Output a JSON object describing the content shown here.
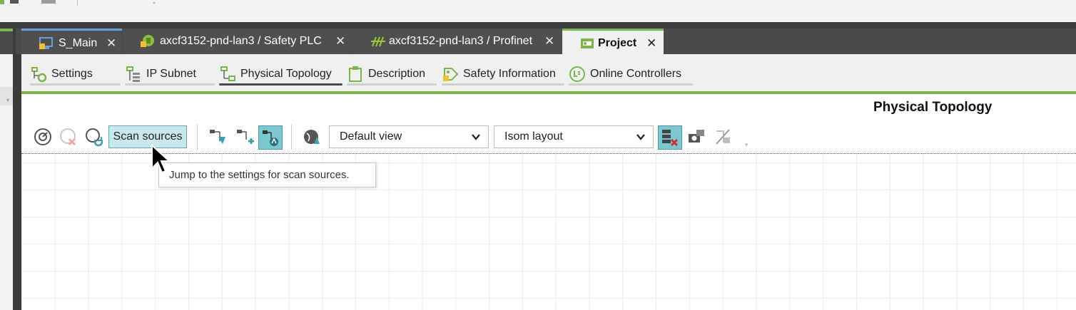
{
  "document_tabs": [
    {
      "label": "S_Main",
      "icon": "monitor-lock-icon",
      "active": false
    },
    {
      "label": "axcf3152-pnd-lan3 / Safety PLC",
      "icon": "safety-plc-icon",
      "active": false
    },
    {
      "label": "axcf3152-pnd-lan3 / Profinet",
      "icon": "profinet-icon",
      "active": false
    },
    {
      "label": "Project",
      "icon": "project-icon",
      "active": true
    }
  ],
  "close_glyph": "✕",
  "sub_tabs": [
    {
      "label": "Settings",
      "icon": "settings-tree-icon"
    },
    {
      "label": "IP Subnet",
      "icon": "ip-subnet-icon"
    },
    {
      "label": "Physical Topology",
      "icon": "topology-icon",
      "active": true
    },
    {
      "label": "Description",
      "icon": "clipboard-icon"
    },
    {
      "label": "Safety Information",
      "icon": "safety-tag-icon"
    },
    {
      "label": "Online Controllers",
      "icon": "online-controllers-icon"
    }
  ],
  "panel": {
    "title": "Physical Topology",
    "scan_sources_label": "Scan sources",
    "view_select": {
      "value": "Default view"
    },
    "layout_select": {
      "value": "Isom layout"
    },
    "tooltip": "Jump to the settings for scan sources."
  },
  "colors": {
    "accent_green": "#7ab648",
    "toggle_teal": "#7cc8d0",
    "dark_chrome": "#4a4a4a"
  }
}
